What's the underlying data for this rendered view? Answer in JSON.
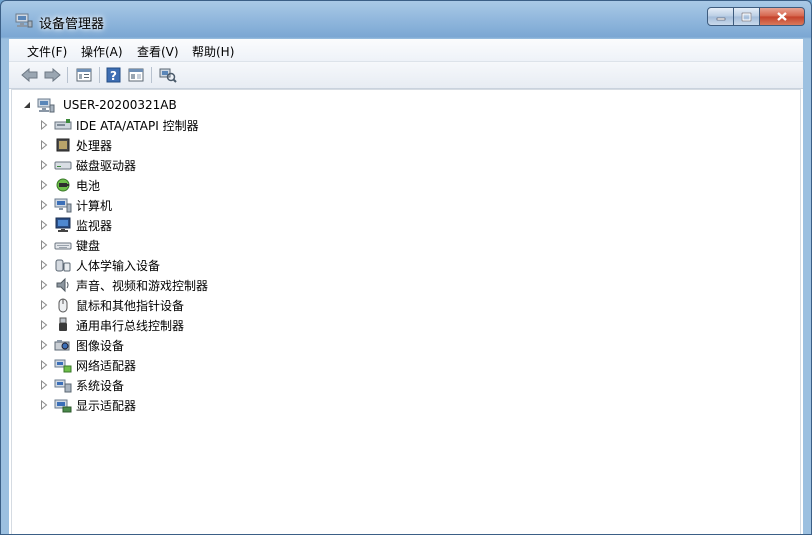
{
  "window": {
    "title": "设备管理器"
  },
  "menu": [
    {
      "label": "文件(F)"
    },
    {
      "label": "操作(A)"
    },
    {
      "label": "查看(V)"
    },
    {
      "label": "帮助(H)"
    }
  ],
  "toolbar": {
    "buttons": [
      "back-arrow-icon",
      "forward-arrow-icon",
      "console-tree-icon",
      "help-icon",
      "properties-icon",
      "scan-hardware-icon"
    ]
  },
  "tree": {
    "root": {
      "label": "USER-20200321AB",
      "icon": "computer-icon"
    },
    "items": [
      {
        "label": "IDE ATA/ATAPI 控制器",
        "icon": "ide-controller-icon"
      },
      {
        "label": "处理器",
        "icon": "processor-icon"
      },
      {
        "label": "磁盘驱动器",
        "icon": "disk-drive-icon"
      },
      {
        "label": "电池",
        "icon": "battery-icon"
      },
      {
        "label": "计算机",
        "icon": "computer-icon"
      },
      {
        "label": "监视器",
        "icon": "monitor-icon"
      },
      {
        "label": "键盘",
        "icon": "keyboard-icon"
      },
      {
        "label": "人体学输入设备",
        "icon": "hid-icon"
      },
      {
        "label": "声音、视频和游戏控制器",
        "icon": "speaker-icon"
      },
      {
        "label": "鼠标和其他指针设备",
        "icon": "mouse-icon"
      },
      {
        "label": "通用串行总线控制器",
        "icon": "usb-icon"
      },
      {
        "label": "图像设备",
        "icon": "camera-icon"
      },
      {
        "label": "网络适配器",
        "icon": "network-adapter-icon"
      },
      {
        "label": "系统设备",
        "icon": "system-device-icon"
      },
      {
        "label": "显示适配器",
        "icon": "display-adapter-icon"
      }
    ]
  },
  "colors": {
    "titlebar": "#8fb6dc",
    "close_button": "#c4402a",
    "tree_background": "#ffffff"
  }
}
